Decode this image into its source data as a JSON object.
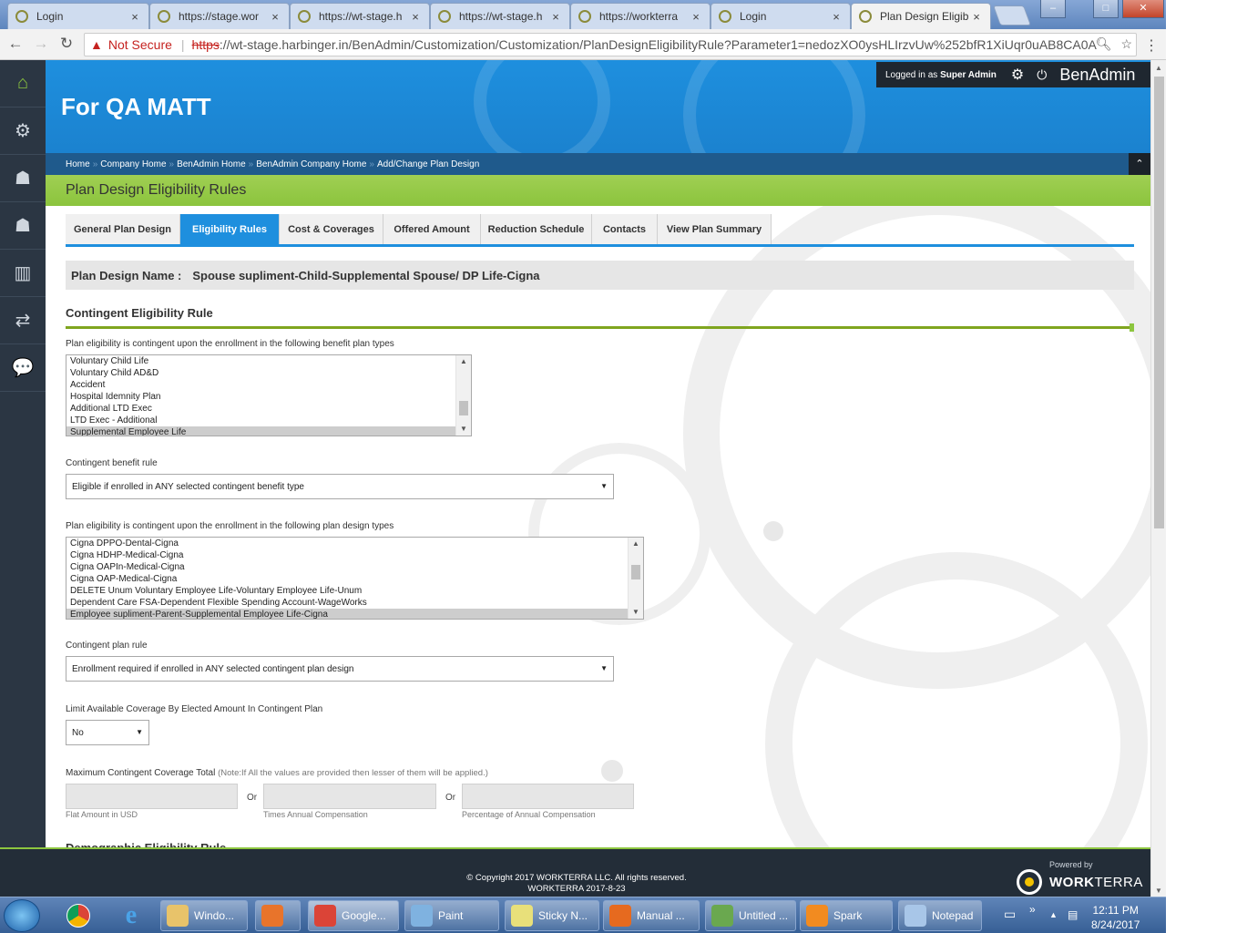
{
  "browser": {
    "tabs": [
      {
        "title": "Login"
      },
      {
        "title": "https://stage.wor"
      },
      {
        "title": "https://wt-stage.h"
      },
      {
        "title": "https://wt-stage.h"
      },
      {
        "title": "https://workterra"
      },
      {
        "title": "Login"
      },
      {
        "title": "Plan Design Eligib"
      }
    ],
    "tab_close_glyph": "×",
    "window_controls": {
      "minimize": "–",
      "maximize": "□",
      "close": "✕"
    },
    "nav": {
      "back": "←",
      "forward": "→",
      "reload": "↻"
    },
    "security_label": "Not Secure",
    "url_scheme": "https",
    "url_rest": "://wt-stage.harbinger.in/BenAdmin/Customization/Customization/PlanDesignEligibilityRule?Parameter1=nedozXO0ysHLIrzvUw%252bfR1XiUqr0uAB8CA0A",
    "menu_glyph": "⋮"
  },
  "leftnav": {
    "items": [
      {
        "icon": "home-icon",
        "glyph": "⌂"
      },
      {
        "icon": "settings-gears-icon",
        "glyph": "⚙"
      },
      {
        "icon": "user-settings-icon",
        "glyph": "☗"
      },
      {
        "icon": "user-icon",
        "glyph": "☗"
      },
      {
        "icon": "bar-chart-icon",
        "glyph": "▥"
      },
      {
        "icon": "transfer-arrows-icon",
        "glyph": "⇄"
      },
      {
        "icon": "chat-icon",
        "glyph": "💬"
      }
    ]
  },
  "header": {
    "company_name": "For QA MATT",
    "logged_in_prefix": "Logged in as ",
    "logged_in_user": "Super Admin",
    "gear_glyph": "⚙",
    "power_glyph": "⏻",
    "app_name": "BenAdmin"
  },
  "breadcrumb": {
    "items": [
      "Home",
      "Company Home",
      "BenAdmin Home",
      "BenAdmin Company Home",
      "Add/Change Plan Design"
    ],
    "separator": "»",
    "collapse_glyph": "⌃"
  },
  "page_title": "Plan Design Eligibility Rules",
  "tabs": [
    {
      "label": "General Plan Design",
      "active": false
    },
    {
      "label": "Eligibility Rules",
      "active": true
    },
    {
      "label": "Cost & Coverages",
      "active": false
    },
    {
      "label": "Offered Amount",
      "active": false
    },
    {
      "label": "Reduction Schedule",
      "active": false
    },
    {
      "label": "Contacts",
      "active": false
    },
    {
      "label": "View Plan Summary",
      "active": false
    }
  ],
  "plan_design": {
    "label": "Plan Design Name :",
    "value": "Spouse supliment-Child-Supplemental Spouse/ DP Life-Cigna"
  },
  "contingent_section": {
    "title": "Contingent Eligibility Rule",
    "benefit_types_label": "Plan eligibility is contingent upon the enrollment in the following benefit plan types",
    "benefit_types": [
      "Voluntary Child Life",
      "Voluntary Child AD&D",
      "Accident",
      "Hospital Idemnity Plan",
      "Additional LTD Exec",
      "LTD Exec - Additional",
      "Supplemental Employee Life"
    ],
    "benefit_types_selected": "Supplemental Employee Life",
    "benefit_rule_label": "Contingent benefit rule",
    "benefit_rule_value": "Eligible if enrolled in ANY selected contingent benefit type",
    "plan_designs_label": "Plan eligibility is contingent upon the enrollment in the following plan design types",
    "plan_designs": [
      "Cigna DPPO-Dental-Cigna",
      "Cigna HDHP-Medical-Cigna",
      "Cigna OAPIn-Medical-Cigna",
      "Cigna OAP-Medical-Cigna",
      "DELETE Unum Voluntary Employee Life-Voluntary Employee Life-Unum",
      "Dependent Care FSA-Dependent Flexible Spending Account-WageWorks",
      "Employee supliment-Parent-Supplemental Employee Life-Cigna"
    ],
    "plan_designs_selected": "Employee supliment-Parent-Supplemental Employee Life-Cigna",
    "plan_rule_label": "Contingent plan rule",
    "plan_rule_value": "Enrollment required if enrolled in ANY selected contingent plan design",
    "limit_label": "Limit Available Coverage By Elected Amount In Contingent Plan",
    "limit_value": "No",
    "max_total_label": "Maximum Contingent Coverage Total",
    "max_total_note": "(Note:If All the values are provided then lesser of them will be applied.)",
    "or_label": "Or",
    "field_hints": [
      "Flat Amount in USD",
      "Times Annual Compensation",
      "Percentage of Annual Compensation"
    ],
    "dropdown_glyph": "▼"
  },
  "next_section_title": "Demographic Eligibility Rule",
  "footer": {
    "copyright": "© Copyright 2017 WORKTERRA LLC. All rights reserved.",
    "version": "WORKTERRA 2017-8-23",
    "powered_by": "Powered by",
    "brand_prefix": "WORK",
    "brand_suffix": "TERRA"
  },
  "taskbar": {
    "buttons": [
      {
        "label": "Windo...",
        "icon": "folder-icon",
        "color": "#e8c36a"
      },
      {
        "label": "",
        "icon": "media-player-icon",
        "color": "#e8742b"
      },
      {
        "label": "Google...",
        "icon": "chrome-icon",
        "color": "#db4437"
      },
      {
        "label": "Paint",
        "icon": "paint-icon",
        "color": "#7fb2e0"
      },
      {
        "label": "Sticky N...",
        "icon": "sticky-notes-icon",
        "color": "#e8e07a"
      },
      {
        "label": "Manual ...",
        "icon": "firefox-icon",
        "color": "#e66a1f"
      },
      {
        "label": "Untitled ...",
        "icon": "spreadsheet-icon",
        "color": "#6aa84f"
      },
      {
        "label": "Spark",
        "icon": "spark-icon",
        "color": "#f28b20"
      },
      {
        "label": "Notepad",
        "icon": "notepad-icon",
        "color": "#a8c6e8"
      }
    ],
    "time": "12:11 PM",
    "date": "8/24/2017",
    "tray_expand": "»"
  }
}
